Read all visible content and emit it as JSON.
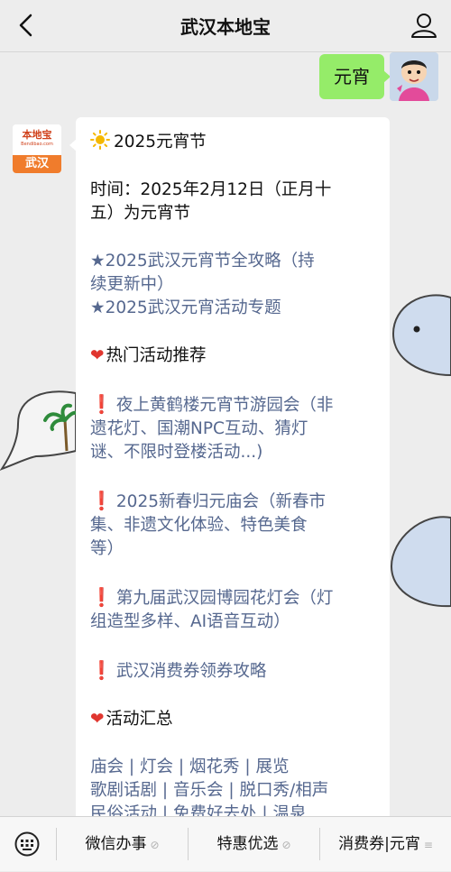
{
  "header": {
    "title": "武汉本地宝"
  },
  "messages": {
    "outgoing_text": "元宵",
    "bot_logo": {
      "text": "本地宝",
      "sub": "Bendibao.com",
      "city": "武汉"
    },
    "article": {
      "heading": "2025元宵节",
      "time_line_1": "时间：2025年2月12日（正月十",
      "time_line_2": "五）为元宵节",
      "link1_l1": "★2025武汉元宵节全攻略（持",
      "link1_l2": "续更新中）",
      "link2": "★2025武汉元宵活动专题",
      "section1": "热门活动推荐",
      "ev1_l1": "夜上黄鹤楼元宵节游园会（非",
      "ev1_l2": "遗花灯、国潮NPC互动、猜灯",
      "ev1_l3": "谜、不限时登楼活动...)",
      "ev2_l1": "2025新春归元庙会（新春市",
      "ev2_l2": "集、非遗文化体验、特色美食",
      "ev2_l3": "等）",
      "ev3_l1": "第九届武汉园博园花灯会（灯",
      "ev3_l2": "组造型多样、AI语音互动）",
      "ev4": "武汉消费券领券攻略",
      "section2": "活动汇总",
      "sum_l1": "庙会 | 灯会 | 烟花秀 | 展览",
      "sum_l2": "歌剧话剧 | 音乐会 | 脱口秀/相声",
      "sum_l3": "民俗活动 | 免费好去处 | 温泉"
    }
  },
  "menu": [
    {
      "label": "微信办事"
    },
    {
      "label": "特惠优选"
    },
    {
      "label": "消费券|元宵"
    }
  ],
  "colors": {
    "bubble_green": "#95ec69",
    "link_blue": "#56688f",
    "accent_red": "#e0362f"
  }
}
